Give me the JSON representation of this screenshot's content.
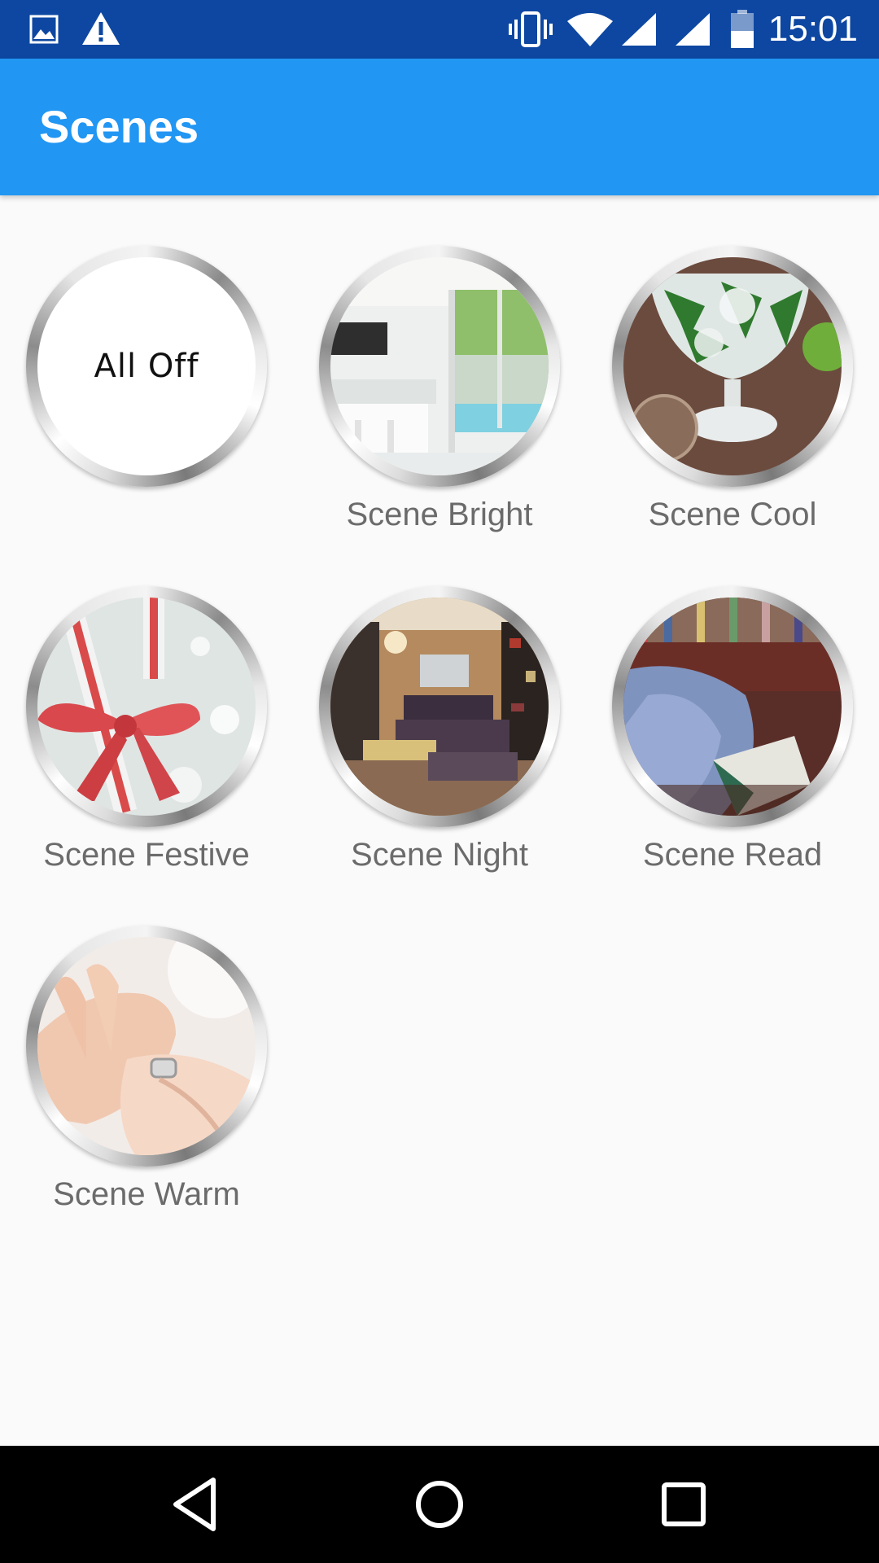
{
  "status_bar": {
    "time": "15:01",
    "icons": [
      "image-icon",
      "warning-icon",
      "vibrate-icon",
      "wifi-icon",
      "signal-icon",
      "signal-icon",
      "battery-icon"
    ]
  },
  "app_bar": {
    "title": "Scenes"
  },
  "scenes": [
    {
      "label": "",
      "center_text": "All Off"
    },
    {
      "label": "Scene Bright"
    },
    {
      "label": "Scene Cool"
    },
    {
      "label": "Scene Festive"
    },
    {
      "label": "Scene Night"
    },
    {
      "label": "Scene Read"
    },
    {
      "label": "Scene Warm"
    }
  ],
  "nav_bar": {
    "icons": [
      "back-icon",
      "home-icon",
      "recents-icon"
    ]
  },
  "colors": {
    "status_bar": "#0d47a1",
    "app_bar": "#2196f3",
    "background": "#fafafa",
    "label": "#6b6b6b"
  }
}
